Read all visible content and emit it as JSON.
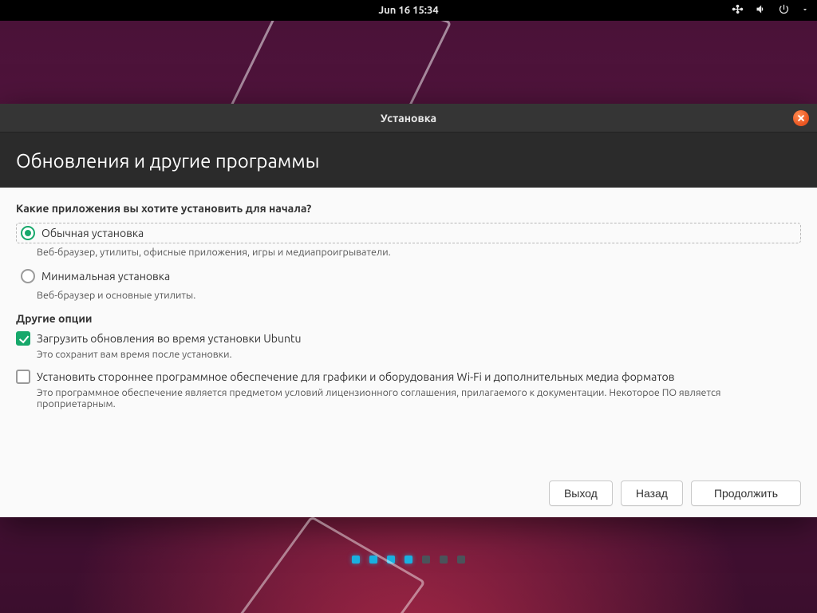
{
  "topbar": {
    "clock": "Jun 16  15:34"
  },
  "installer": {
    "window_title": "Установка",
    "page_title": "Обновления и другие программы",
    "question": "Какие приложения вы хотите установить для начала?",
    "options": {
      "normal": {
        "label": "Обычная установка",
        "desc": "Веб-браузер, утилиты, офисные приложения, игры и медиапроигрыватели.",
        "selected": true
      },
      "minimal": {
        "label": "Минимальная установка",
        "desc": "Веб-браузер и основные утилиты.",
        "selected": false
      }
    },
    "other_title": "Другие опции",
    "checks": {
      "download_updates": {
        "label": "Загрузить обновления во время установки Ubuntu",
        "desc": "Это сохранит вам время после установки.",
        "checked": true
      },
      "third_party": {
        "label": "Установить стороннее программное обеспечение для графики и оборудования Wi-Fi и дополнительных медиа форматов",
        "desc": "Это программное обеспечение является предметом условий лицензионного соглашения, прилагаемого к документации. Некоторое ПО является проприетарным.",
        "checked": false
      }
    },
    "buttons": {
      "quit": "Выход",
      "back": "Назад",
      "continue": "Продолжить"
    },
    "progress": {
      "total": 7,
      "current": 4
    }
  }
}
